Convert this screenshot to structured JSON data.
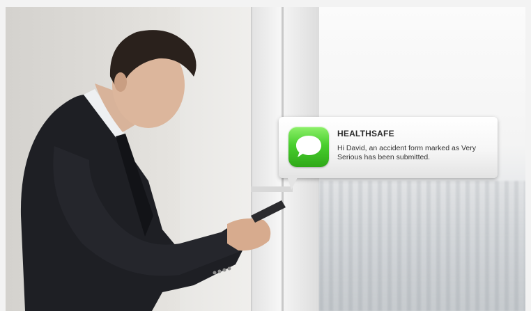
{
  "notification": {
    "app_name": "HEALTHSAFE",
    "icon": "messages-icon",
    "message": "Hi David, an accident form marked as Very Serious has been submitted."
  },
  "colors": {
    "icon_green": "#49cf2f",
    "bubble_bg": "#f6f6f6",
    "suit": "#1e1f24"
  }
}
